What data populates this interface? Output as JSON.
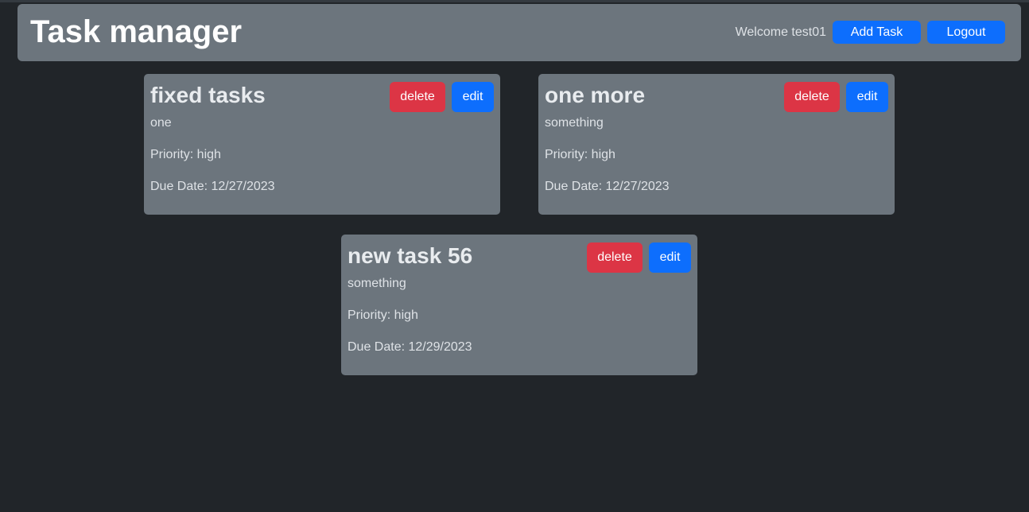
{
  "header": {
    "title": "Task manager",
    "welcome": "Welcome test01",
    "add_task_label": "Add Task",
    "logout_label": "Logout"
  },
  "tasks": [
    {
      "title": "fixed tasks",
      "description": "one",
      "priority": "Priority: high",
      "due": "Due Date: 12/27/2023",
      "delete_label": "delete",
      "edit_label": "edit"
    },
    {
      "title": "one more",
      "description": "something",
      "priority": "Priority: high",
      "due": "Due Date: 12/27/2023",
      "delete_label": "delete",
      "edit_label": "edit"
    },
    {
      "title": "new task 56",
      "description": "something",
      "priority": "Priority: high",
      "due": "Due Date: 12/29/2023",
      "delete_label": "delete",
      "edit_label": "edit"
    }
  ],
  "colors": {
    "background": "#212529",
    "panel": "#6c757d",
    "primary": "#0d6efd",
    "danger": "#dc3545"
  }
}
